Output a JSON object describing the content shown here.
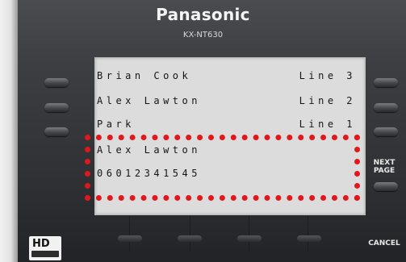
{
  "device": {
    "brand": "Panasonic",
    "model": "KX-NT630"
  },
  "display": {
    "rows": [
      {
        "name": "Brian Cook",
        "line": "Line 3"
      },
      {
        "name": "Alex Lawton",
        "line": "Line 2"
      },
      {
        "name": "Park",
        "line": "Line 1"
      },
      {
        "name": "Alex Lawton",
        "line": ""
      },
      {
        "name": "06012341545",
        "line": ""
      }
    ]
  },
  "keys": {
    "next_page": "NEXT PAGE",
    "cancel": "CANCEL",
    "hd_logo": "HD"
  },
  "colors": {
    "highlight": "#e0181c",
    "lcd_background": "#dcdcdc"
  }
}
